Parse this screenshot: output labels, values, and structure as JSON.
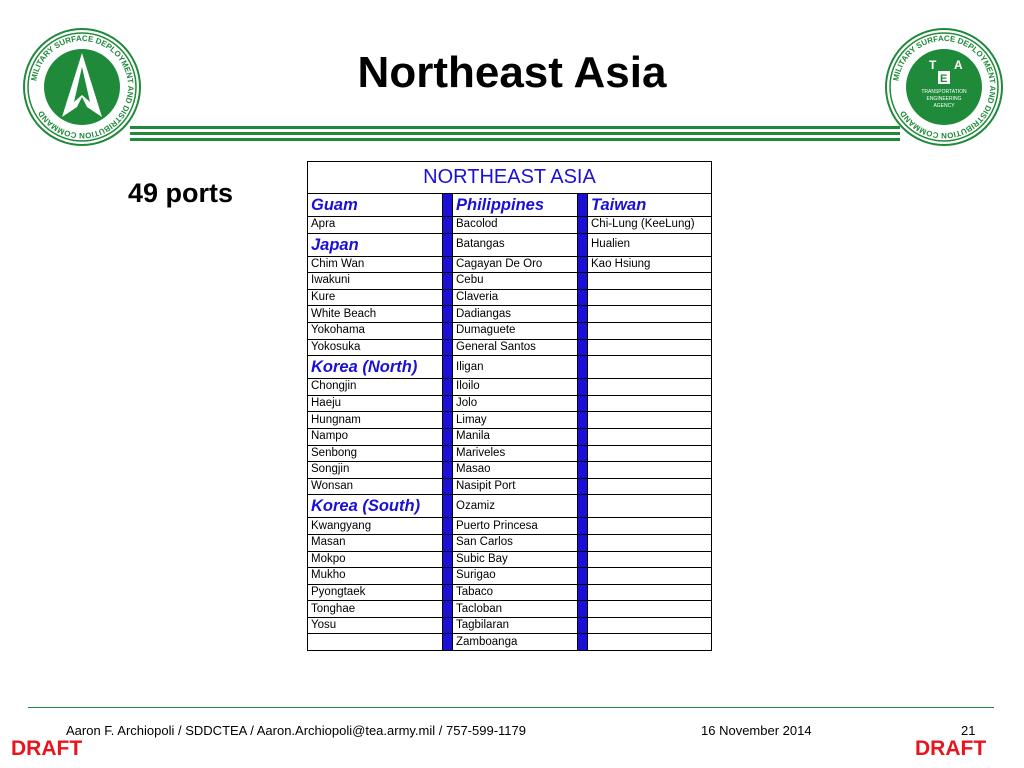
{
  "slide": {
    "title": "Northeast Asia",
    "ports_label": "49 ports"
  },
  "logos": {
    "left": {
      "ring_text": "MILITARY SURFACE DEPLOYMENT AND DISTRIBUTION COMMAND"
    },
    "right": {
      "ring_text": "MILITARY SURFACE DEPLOYMENT AND DISTRIBUTION COMMAND",
      "letters": [
        "T",
        "A",
        "E"
      ],
      "inner_text": [
        "TRANSPORTATION",
        "ENGINEERING",
        "AGENCY"
      ]
    }
  },
  "table": {
    "header": "NORTHEAST ASIA",
    "rows": [
      {
        "c1": "Guam",
        "c1_sec": true,
        "c2": "Philippines",
        "c2_sec": true,
        "c3": "Taiwan",
        "c3_sec": true
      },
      {
        "c1": "Apra",
        "c2": "Bacolod",
        "c3": "Chi-Lung (KeeLung)"
      },
      {
        "c1": "Japan",
        "c1_sec": true,
        "c2": "Batangas",
        "c3": "Hualien"
      },
      {
        "c1": "Chim Wan",
        "c2": "Cagayan De Oro",
        "c3": "Kao Hsiung"
      },
      {
        "c1": "Iwakuni",
        "c2": "Cebu",
        "c3": ""
      },
      {
        "c1": "Kure",
        "c2": "Claveria",
        "c3": ""
      },
      {
        "c1": "White Beach",
        "c2": "Dadiangas",
        "c3": ""
      },
      {
        "c1": "Yokohama",
        "c2": "Dumaguete",
        "c3": ""
      },
      {
        "c1": "Yokosuka",
        "c2": "General Santos",
        "c3": ""
      },
      {
        "c1": "Korea (North)",
        "c1_sec": true,
        "c2": "Iligan",
        "c3": ""
      },
      {
        "c1": "Chongjin",
        "c2": "Iloilo",
        "c3": ""
      },
      {
        "c1": "Haeju",
        "c2": "Jolo",
        "c3": ""
      },
      {
        "c1": "Hungnam",
        "c2": "Limay",
        "c3": ""
      },
      {
        "c1": "Nampo",
        "c2": "Manila",
        "c3": ""
      },
      {
        "c1": "Senbong",
        "c2": "Mariveles",
        "c3": ""
      },
      {
        "c1": "Songjin",
        "c2": "Masao",
        "c3": ""
      },
      {
        "c1": "Wonsan",
        "c2": "Nasipit Port",
        "c3": ""
      },
      {
        "c1": "Korea (South)",
        "c1_sec": true,
        "c2": "Ozamiz",
        "c3": ""
      },
      {
        "c1": "Kwangyang",
        "c2": "Puerto Princesa",
        "c3": ""
      },
      {
        "c1": "Masan",
        "c2": "San Carlos",
        "c3": ""
      },
      {
        "c1": "Mokpo",
        "c2": "Subic Bay",
        "c3": ""
      },
      {
        "c1": "Mukho",
        "c2": "Surigao",
        "c3": ""
      },
      {
        "c1": "Pyongtaek",
        "c2": "Tabaco",
        "c3": ""
      },
      {
        "c1": "Tonghae",
        "c2": "Tacloban",
        "c3": ""
      },
      {
        "c1": "Yosu",
        "c2": "Tagbilaran",
        "c3": ""
      },
      {
        "c1": "",
        "c2": "Zamboanga",
        "c3": ""
      }
    ]
  },
  "footer": {
    "author": "Aaron F. Archiopoli / SDDCTEA / Aaron.Archiopoli@tea.army.mil / 757-599-1179",
    "date": "16 November 2014",
    "page": "21",
    "draft_left": "DRAFT",
    "draft_right": "DRAFT"
  },
  "colors": {
    "green": "#1f8a3a",
    "blue": "#1a10d6",
    "draft_red": "#e8141e"
  }
}
